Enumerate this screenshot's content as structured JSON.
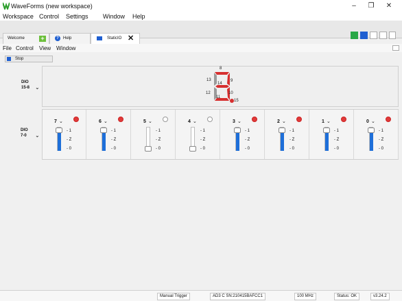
{
  "window": {
    "title": "WaveForms (new workspace)",
    "minimize": "–",
    "restore": "❐",
    "close": "✕"
  },
  "menu": [
    "Workspace",
    "Control",
    "Settings",
    "Window",
    "Help"
  ],
  "tabs": [
    {
      "label": "Welcome"
    },
    {
      "label": "Help"
    },
    {
      "label": "StaticIO"
    }
  ],
  "submenu": [
    "File",
    "Control",
    "View",
    "Window"
  ],
  "stop_label": "Stop",
  "dio_high": {
    "label": "DIO\n15-8",
    "segments": [
      "8",
      "9",
      "10",
      "11",
      "12",
      "13",
      "14",
      "15"
    ]
  },
  "dio_low": {
    "label": "DIO\n7-0"
  },
  "channels": [
    {
      "num": "7",
      "led": "on",
      "level": 1
    },
    {
      "num": "6",
      "led": "on",
      "level": 1
    },
    {
      "num": "5",
      "led": "off",
      "level": 0
    },
    {
      "num": "4",
      "led": "off",
      "level": 0
    },
    {
      "num": "3",
      "led": "on",
      "level": 1
    },
    {
      "num": "2",
      "led": "on",
      "level": 1
    },
    {
      "num": "1",
      "led": "on",
      "level": 1
    },
    {
      "num": "0",
      "led": "on",
      "level": 1
    }
  ],
  "options": [
    "1",
    "Z",
    "0"
  ],
  "status": {
    "trigger": "Manual Trigger",
    "device": "AD3 C SN:210415BAFCC1",
    "clock": "100 MHz",
    "state": "Status: OK",
    "version": "v3.24.2"
  },
  "colors": {
    "accent": "#1e6fd9",
    "led_on": "#e03a3a",
    "segment_on": "#d62f2f",
    "segment_off": "#9a9a9a"
  }
}
